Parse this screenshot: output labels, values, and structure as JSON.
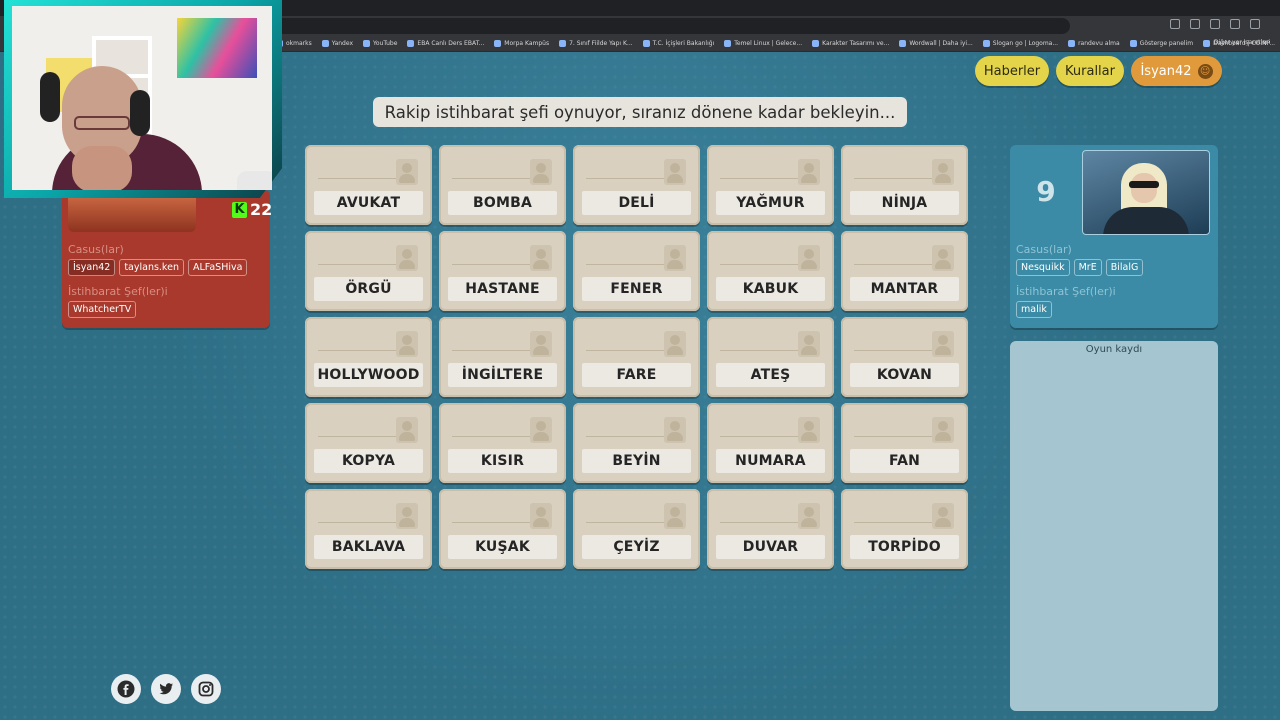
{
  "bookmarks": [
    "okmarks",
    "Yandex",
    "YouTube",
    "EBA Canlı Ders EBAT...",
    "Morpa Kampüs",
    "7. Sınıf Fiilde Yapı K...",
    "T.C. İçişleri Bakanlığı",
    "Temel Linux | Gelece...",
    "Karakter Tasarımı ve...",
    "Wordwall | Daha iyi...",
    "Slogan go | Logoma...",
    "randevu alma",
    "Gösterge panelim",
    "Dashboard | COINP..."
  ],
  "bookmarks_other": "Diğer yer işaretleri",
  "header": {
    "news": "Haberler",
    "rules": "Kurallar",
    "user": "İsyan42"
  },
  "banner": "Rakip istihbarat şefi oynuyor, sıranız dönene kadar bekleyin...",
  "cards": [
    "AVUKAT",
    "BOMBA",
    "DELİ",
    "YAĞMUR",
    "NİNJA",
    "ÖRGÜ",
    "HASTANE",
    "FENER",
    "KABUK",
    "MANTAR",
    "HOLLYWOOD",
    "İNGİLTERE",
    "FARE",
    "ATEŞ",
    "KOVAN",
    "KOPYA",
    "KISIR",
    "BEYİN",
    "NUMARA",
    "FAN",
    "BAKLAVA",
    "KUŞAK",
    "ÇEYİZ",
    "DUVAR",
    "TORPİDO"
  ],
  "red_team": {
    "spies_heading": "Casus(lar)",
    "spies": [
      "İsyan42",
      "taylans.ken",
      "ALFaSHiva"
    ],
    "chiefs_heading": "İstihbarat Şef(ler)i",
    "chiefs": [
      "WhatcherTV"
    ]
  },
  "blue_team": {
    "remaining": "9",
    "spies_heading": "Casus(lar)",
    "spies": [
      "Nesquikk",
      "MrE",
      "BilalG"
    ],
    "chiefs_heading": "İstihbarat Şef(ler)i",
    "chiefs": [
      "malik"
    ]
  },
  "log": {
    "title": "Oyun kaydı"
  },
  "kick": {
    "viewers": "22",
    "k": "K"
  },
  "social": [
    "facebook-icon",
    "twitter-icon",
    "instagram-icon"
  ],
  "colors": {
    "red": "#a8392c",
    "blue": "#3b8ba6",
    "yellow": "#e4d44a",
    "orange": "#e09a3c",
    "card": "#d9d0bf"
  }
}
